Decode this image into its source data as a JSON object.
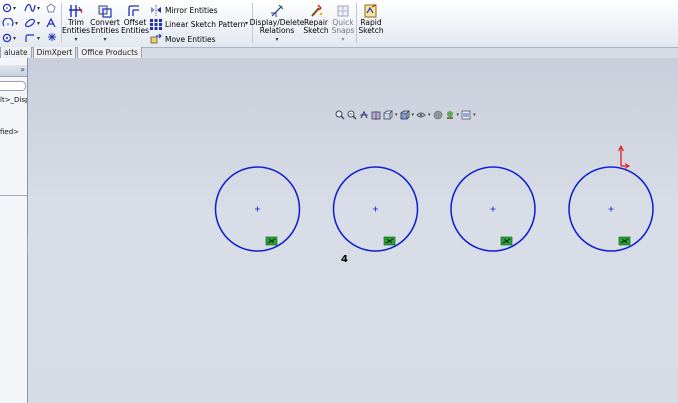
{
  "ribbon": {
    "trim_entities": "Trim\nEntities",
    "convert_entities": "Convert\nEntities",
    "offset_entities": "Offset\nEntities",
    "mirror_entities": "Mirror Entities",
    "linear_sketch_pattern": "Linear Sketch Pattern",
    "move_entities": "Move Entities",
    "display_delete_relations": "Display/Delete\nRelations",
    "repair_sketch": "Repair\nSketch",
    "quick_snaps": "Quick\nSnaps",
    "rapid_sketch": "Rapid\nSketch"
  },
  "tabs": [
    "aluate",
    "DimXpert",
    "Office Products"
  ],
  "panel": {
    "expand_glyph": "»",
    "item_1": "lt>_Disp",
    "item_2": "fied>"
  },
  "canvas": {
    "dimension_label": "4",
    "relation_icons": [
      "coincident-fix-icon",
      "coincident-fix-icon",
      "coincident-fix-icon",
      "coincident-fix-icon"
    ]
  },
  "colors": {
    "sketch_blue": "#0b1fd0",
    "relation_green": "#27a338",
    "origin_red": "#e01010"
  }
}
